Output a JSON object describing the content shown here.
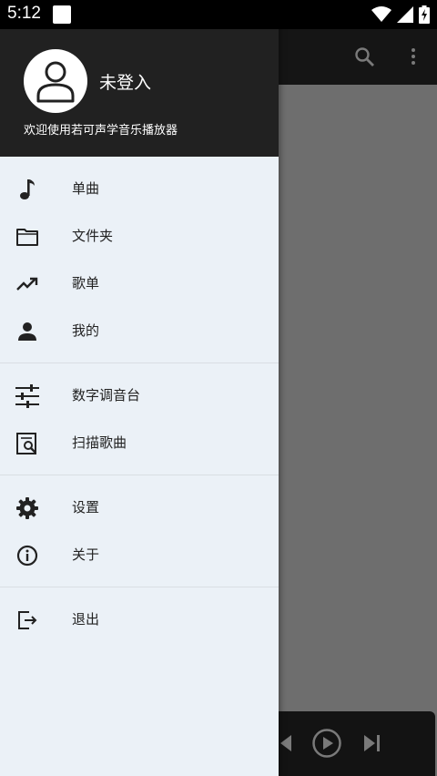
{
  "status_bar": {
    "time": "5:12",
    "icons": [
      "notification-square-icon",
      "wifi-icon",
      "signal-icon",
      "battery-charging-icon"
    ]
  },
  "background_app": {
    "toolbar_icons": [
      "search-icon",
      "more-vert-icon"
    ],
    "player_icons": [
      "previous-icon",
      "play-icon",
      "next-icon"
    ]
  },
  "drawer": {
    "header": {
      "username": "未登入",
      "welcome": "欢迎使用若可声学音乐播放器",
      "avatar_icon": "person-icon"
    },
    "groups": [
      {
        "items": [
          {
            "label": "单曲",
            "icon": "music-note-icon"
          },
          {
            "label": "文件夹",
            "icon": "folder-icon"
          },
          {
            "label": "歌单",
            "icon": "trending-up-icon"
          },
          {
            "label": "我的",
            "icon": "person-icon"
          }
        ]
      },
      {
        "items": [
          {
            "label": "数字调音台",
            "icon": "equalizer-sliders-icon"
          },
          {
            "label": "扫描歌曲",
            "icon": "scan-search-icon"
          }
        ]
      },
      {
        "items": [
          {
            "label": "设置",
            "icon": "settings-gear-icon"
          },
          {
            "label": "关于",
            "icon": "info-icon"
          }
        ]
      },
      {
        "items": [
          {
            "label": "退出",
            "icon": "exit-icon"
          }
        ]
      }
    ]
  }
}
